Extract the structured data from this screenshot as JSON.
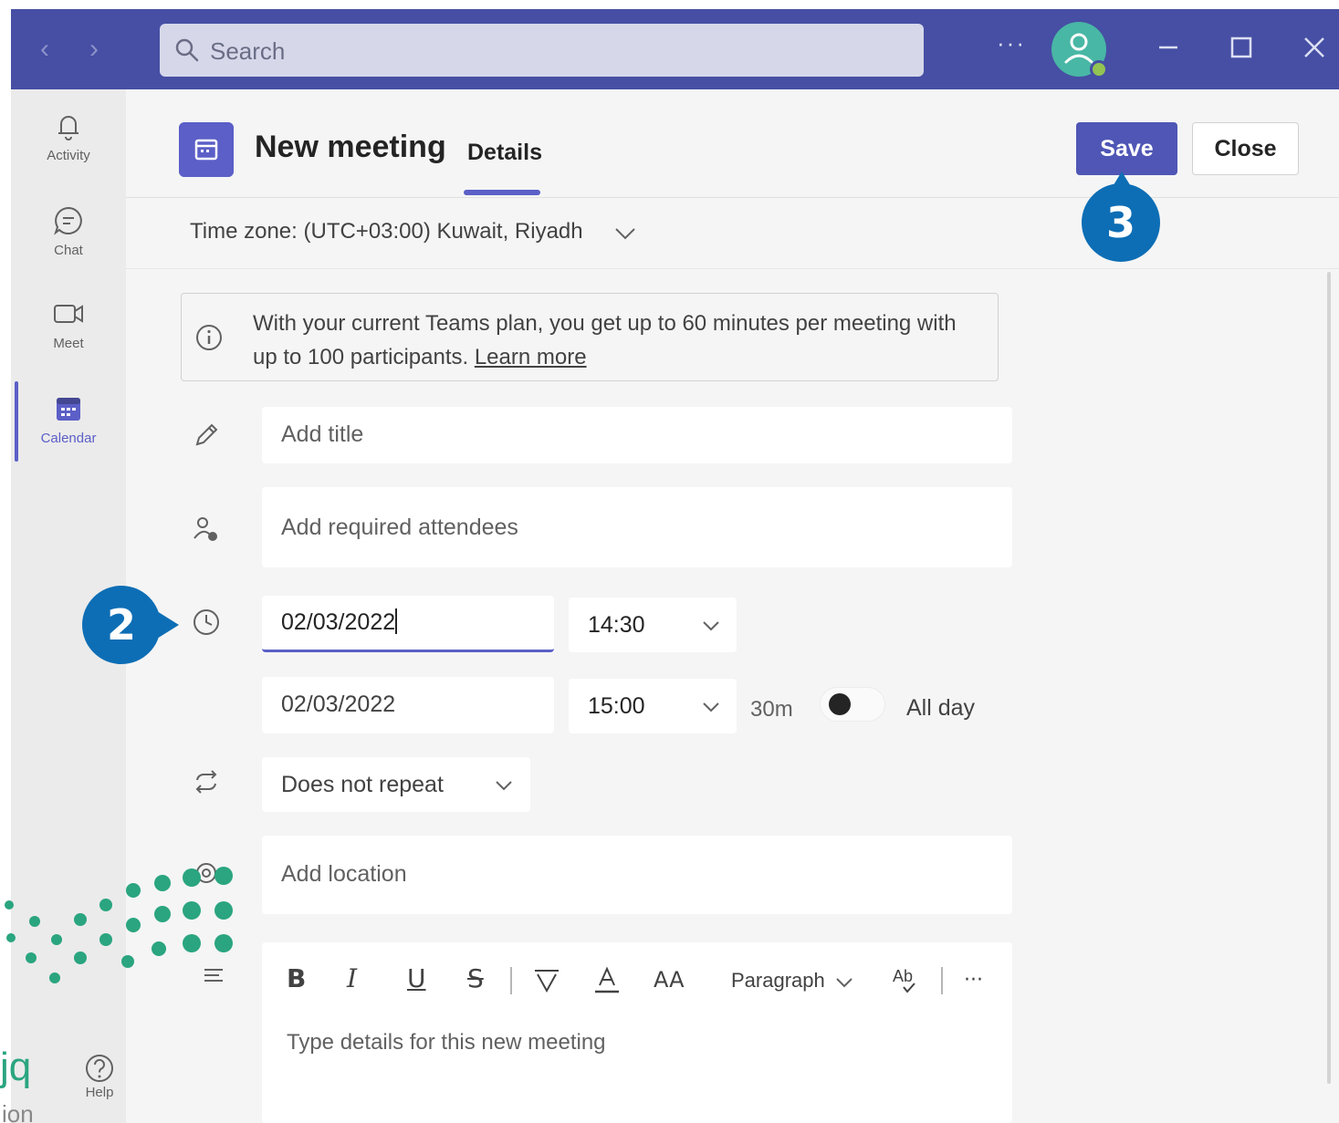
{
  "search": {
    "placeholder": "Search"
  },
  "titlebar": {
    "more": "···"
  },
  "rail": {
    "items": [
      {
        "label": "Activity",
        "icon": "bell-icon"
      },
      {
        "label": "Chat",
        "icon": "chat-icon"
      },
      {
        "label": "Meet",
        "icon": "video-icon"
      },
      {
        "label": "Calendar",
        "icon": "calendar-icon",
        "active": true
      }
    ],
    "help": "Help"
  },
  "header": {
    "title": "New meeting",
    "tab": "Details",
    "save": "Save",
    "close": "Close"
  },
  "timezone": "Time zone: (UTC+03:00) Kuwait, Riyadh",
  "banner": {
    "text": "With your current Teams plan, you get up to 60 minutes per meeting with up to 100 participants. ",
    "link": "Learn more"
  },
  "form": {
    "title_placeholder": "Add title",
    "attendees_placeholder": "Add required attendees",
    "start_date": "02/03/2022",
    "start_time": "14:30",
    "end_date": "02/03/2022",
    "end_time": "15:00",
    "duration": "30m",
    "all_day": "All day",
    "all_day_on": false,
    "repeat": "Does not repeat",
    "location_placeholder": "Add location",
    "details_placeholder": "Type details for this new meeting"
  },
  "editor": {
    "bold": "B",
    "italic": "I",
    "underline": "U",
    "strike": "S",
    "font_size": "AA",
    "paragraph": "Paragraph",
    "more": "···"
  },
  "callouts": {
    "step2": "2",
    "step3": "3"
  },
  "watermark": {
    "text": "jq",
    "small": "ion"
  },
  "colors": {
    "accent": "#5b5fc7",
    "titlebar": "#464fa4",
    "callout": "#0d6eb5",
    "watermark": "#2aa57f"
  }
}
